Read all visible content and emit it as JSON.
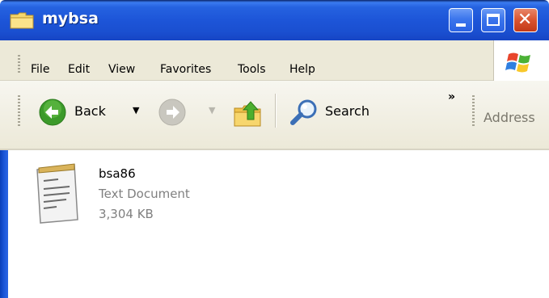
{
  "window": {
    "title": "mybsa"
  },
  "menu": {
    "items": [
      {
        "label": "File"
      },
      {
        "label": "Edit"
      },
      {
        "label": "View"
      },
      {
        "label": "Favorites"
      },
      {
        "label": "Tools"
      },
      {
        "label": "Help"
      }
    ]
  },
  "toolbar": {
    "back_label": "Back",
    "search_label": "Search",
    "chevron": "»",
    "address_label": "Address"
  },
  "files": [
    {
      "name": "bsa86",
      "type": "Text Document",
      "size": "3,304 KB",
      "icon": "text-document-icon"
    }
  ],
  "colors": {
    "titlebar": "#1d55d8",
    "menubar": "#ece9d8",
    "close_button": "#d9532f",
    "back_button": "#3c9a2a"
  }
}
